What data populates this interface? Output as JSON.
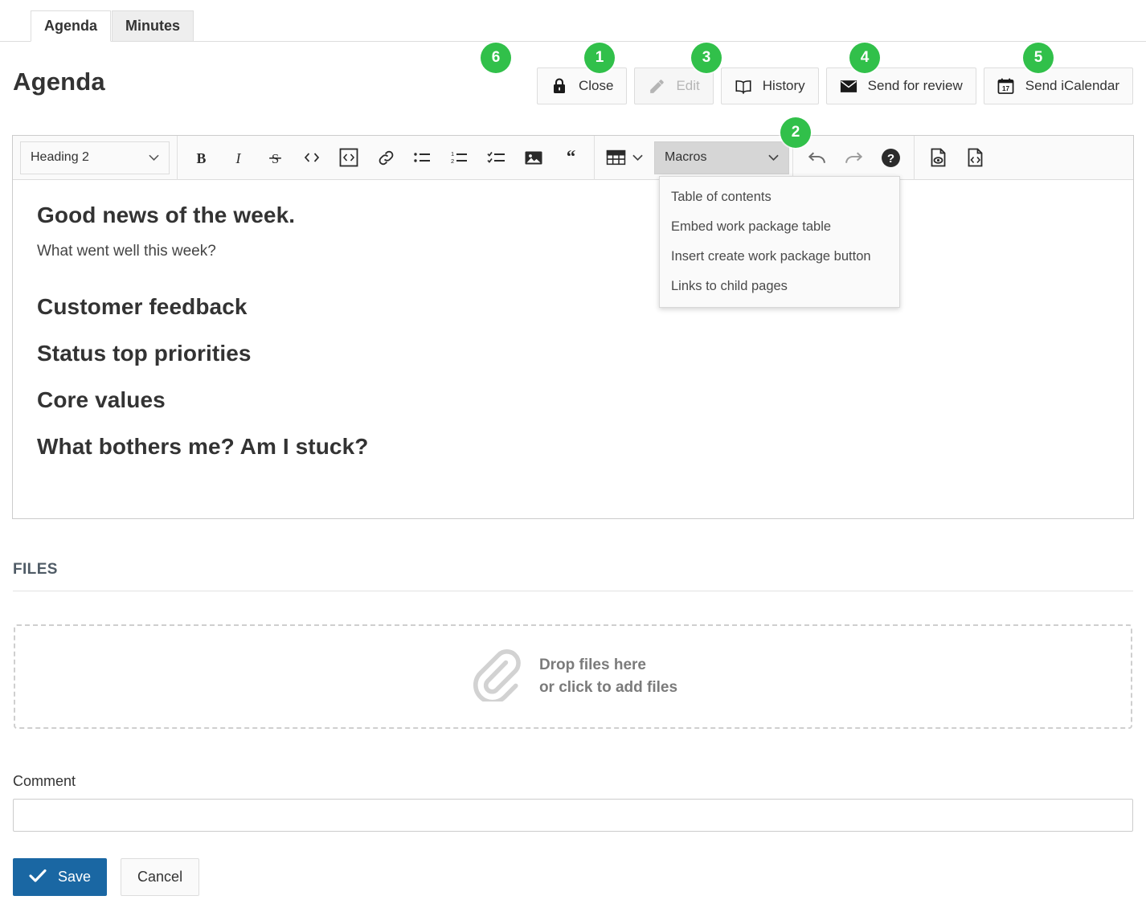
{
  "tabs": [
    {
      "label": "Agenda",
      "active": true
    },
    {
      "label": "Minutes",
      "active": false
    }
  ],
  "header": {
    "title": "Agenda",
    "actions": [
      {
        "label": "Close",
        "icon": "lock-icon",
        "badge": "6",
        "disabled": false
      },
      {
        "label": "Edit",
        "icon": "pencil-icon",
        "badge": "1",
        "disabled": true
      },
      {
        "label": "History",
        "icon": "book-icon",
        "badge": "3",
        "disabled": false
      },
      {
        "label": "Send for review",
        "icon": "envelope-icon",
        "badge": "4",
        "disabled": false
      },
      {
        "label": "Send iCalendar",
        "icon": "calendar-icon",
        "badge": "5",
        "disabled": false
      }
    ],
    "calendar_day": "17"
  },
  "editor": {
    "style_select": {
      "value": "Heading 2"
    },
    "macros_select": {
      "value": "Macros",
      "badge": "2"
    },
    "toolbar_icons": [
      "bold-icon",
      "italic-icon",
      "strikethrough-icon",
      "inline-code-icon",
      "code-block-icon",
      "link-icon",
      "bulleted-list-icon",
      "numbered-list-icon",
      "todo-list-icon",
      "image-icon",
      "blockquote-icon",
      "table-icon",
      "undo-icon",
      "redo-icon",
      "help-icon",
      "preview-icon",
      "markdown-source-icon"
    ],
    "macros_menu": [
      "Table of contents",
      "Embed work package table",
      "Insert create work package button",
      "Links to child pages"
    ],
    "document": [
      {
        "type": "h2",
        "text": "Good news of the week."
      },
      {
        "type": "p",
        "text": "What went well this week?"
      },
      {
        "type": "h2",
        "text": "Customer feedback"
      },
      {
        "type": "h2",
        "text": "Status top priorities"
      },
      {
        "type": "h2",
        "text": "Core values"
      },
      {
        "type": "h2",
        "text": "What bothers me? Am I stuck?"
      }
    ]
  },
  "files": {
    "section_title": "FILES",
    "dropzone_line1": "Drop files here",
    "dropzone_line2": "or click to add files",
    "dropzone_icon": "paperclip-icon"
  },
  "footer": {
    "comment_label": "Comment",
    "comment_value": "",
    "comment_placeholder": "",
    "save_label": "Save",
    "cancel_label": "Cancel"
  },
  "colors": {
    "badge_green": "#31c04a",
    "save_blue": "#1a67a3",
    "border_grey": "#dddddd",
    "tab_inactive_bg": "#eeeeee",
    "macros_active_bg": "#d6d6d6"
  }
}
